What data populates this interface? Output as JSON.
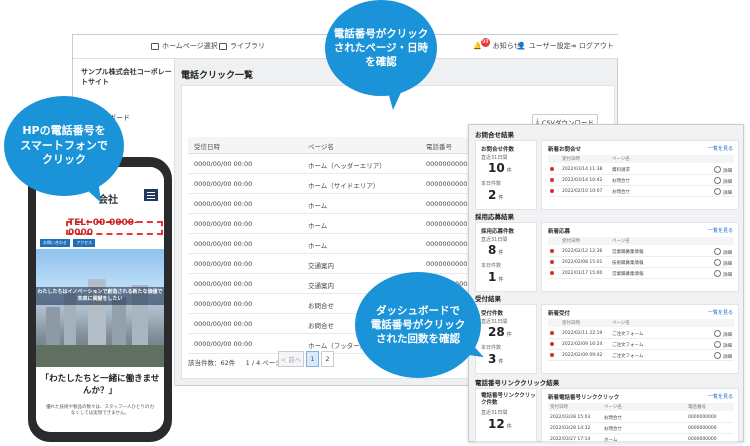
{
  "topbar": {
    "home_select": "ホームページ選択",
    "library": "ライブラリ",
    "notice": "お知らせ",
    "notice_count": "99",
    "user_settings": "ユーザー設定",
    "logout": "ログアウト"
  },
  "sidebar": {
    "company": "サンプル株式会社コーポレートサイト",
    "dashboard": "ダッシュボード"
  },
  "main": {
    "title": "電話クリック一覧",
    "csv_label": "CSVダウンロード",
    "columns": [
      "受信日時",
      "ページ名",
      "電話番号"
    ],
    "rows": [
      {
        "date": "0000/00/00 00:00",
        "page": "ホーム（ヘッダーエリア）",
        "tel": "0000000000"
      },
      {
        "date": "0000/00/00 00:00",
        "page": "ホーム（サイドエリア）",
        "tel": "0000000000"
      },
      {
        "date": "0000/00/00 00:00",
        "page": "ホーム",
        "tel": "0000000000"
      },
      {
        "date": "0000/00/00 00:00",
        "page": "ホーム",
        "tel": "0000000000"
      },
      {
        "date": "0000/00/00 00:00",
        "page": "ホーム",
        "tel": "0000000000"
      },
      {
        "date": "0000/00/00 00:00",
        "page": "交通案内",
        "tel": "0000000000"
      },
      {
        "date": "0000/00/00 00:00",
        "page": "交通案内",
        "tel": "0000000000"
      },
      {
        "date": "0000/00/00 00:00",
        "page": "お問合せ",
        "tel": "0000000000"
      },
      {
        "date": "0000/00/00 00:00",
        "page": "お問合せ",
        "tel": "0000000000"
      },
      {
        "date": "0000/00/00 00:00",
        "page": "ホーム（フッター）",
        "tel": "0000000000"
      }
    ],
    "pager_count": "該当件数：62件",
    "pager_pages": "1 / 4 ページ",
    "prev": "< 前へ",
    "page1": "1",
    "page2": "2"
  },
  "dashboard": {
    "more": "一覧を見る",
    "detail": "詳細",
    "sections": [
      {
        "title": "お問合せ結果",
        "stat_label": "お問合せ件数",
        "sub1": "直近31日間",
        "num1": "10",
        "sub2": "本日件数",
        "num2": "2",
        "unit": "件",
        "list_title": "新着お問合せ",
        "head": [
          "受付日時",
          "ページ名"
        ],
        "rows": [
          {
            "date": "2022/03/14 11:38",
            "page": "資料請求"
          },
          {
            "date": "2022/03/14 10:42",
            "page": "お問合せ"
          },
          {
            "date": "2022/02/10 10:07",
            "page": "お問合せ"
          }
        ]
      },
      {
        "title": "採用応募結果",
        "stat_label": "採用応募件数",
        "sub1": "直近31日間",
        "num1": "8",
        "sub2": "本日件数",
        "num2": "1",
        "unit": "件",
        "list_title": "新着応募",
        "head": [
          "受付日時",
          "ページ名"
        ],
        "rows": [
          {
            "date": "2022/02/12 12:36",
            "page": "営業職募集情報"
          },
          {
            "date": "2022/02/08 15:01",
            "page": "技術職募集情報"
          },
          {
            "date": "2022/01/17 15:00",
            "page": "営業職募集情報"
          }
        ]
      },
      {
        "title": "受付結果",
        "stat_label": "受付件数",
        "sub1": "直近31日間",
        "num1": "28",
        "sub2": "本日件数",
        "num2": "3",
        "unit": "件",
        "list_title": "新着受付",
        "head": [
          "受付日時",
          "ページ名"
        ],
        "rows": [
          {
            "date": "2022/02/11 22:19",
            "page": "ご注文フォーム"
          },
          {
            "date": "2022/02/09 16:24",
            "page": "ご注文フォーム"
          },
          {
            "date": "2022/02/09 09:42",
            "page": "ご注文フォーム"
          }
        ]
      }
    ],
    "phone_section": {
      "title": "電話番号リンククリック結果",
      "stat_label": "電話番号リンククリック件数",
      "sub1": "直近31日間",
      "num1": "12",
      "unit": "件",
      "list_title": "新着電話番号リンククリック",
      "head": [
        "受付日時",
        "ページ名",
        "電話番号"
      ],
      "rows": [
        {
          "date": "2022/03/28 15:03",
          "page": "お問合せ",
          "tel": "0000000000"
        },
        {
          "date": "2022/03/28 14:32",
          "page": "お問合せ",
          "tel": "0000000000"
        },
        {
          "date": "2022/03/27 17:14",
          "page": "ホーム",
          "tel": "0000000000"
        }
      ]
    }
  },
  "phone": {
    "logo": "会社",
    "tel": "TEL: 00-0000-0000",
    "btn1": "お問い合わせ",
    "btn2": "アクセス",
    "overlay": "わたしたちはイノベーションで創造される新たな価値で未来に貢献をしたい",
    "cta": "「わたしたちと一緒に働きませんか？」",
    "foot": "優れた技術や製品の数々は、スタッフ一人ひとりの力なくしては実現できません。"
  },
  "bubbles": {
    "b1": "電話番号がクリック\nされたページ・日時\nを確認",
    "b2": "HPの電話番号を\nスマートフォンで\nクリック",
    "b3": "ダッシュボードで\n電話番号がクリック\nされた回数を確認"
  },
  "colors": {
    "accent": "#1b93d8",
    "alert": "#e53935"
  }
}
